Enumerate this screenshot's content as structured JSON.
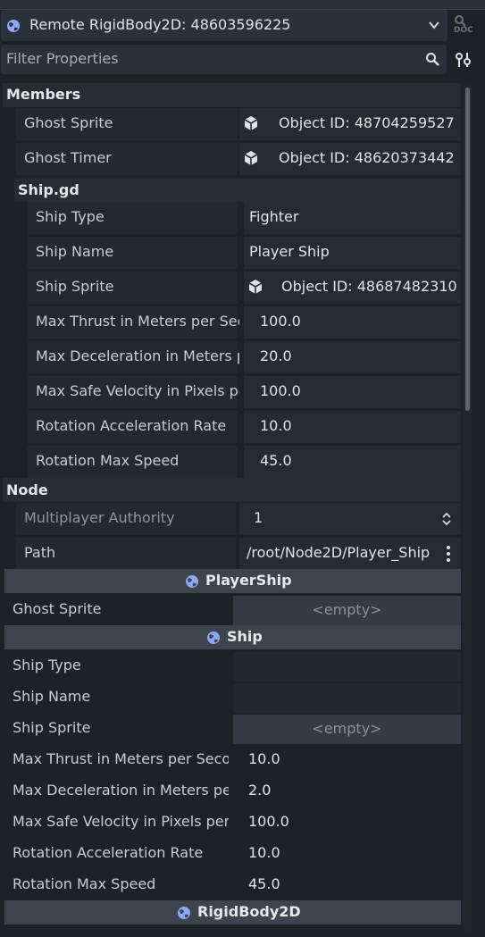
{
  "header": {
    "object_selector": "Remote RigidBody2D: 48603596225",
    "filter_placeholder": "Filter Properties",
    "doc_button": "DOC"
  },
  "members": {
    "title": "Members",
    "ghost_sprite_label": "Ghost Sprite",
    "ghost_sprite_value": "Object ID: 48704259527",
    "ghost_timer_label": "Ghost Timer",
    "ghost_timer_value": "Object ID: 48620373442"
  },
  "shipgd": {
    "title": "Ship.gd",
    "rows": [
      {
        "label": "Ship Type",
        "value": "Fighter"
      },
      {
        "label": "Ship Name",
        "value": "Player Ship"
      },
      {
        "label": "Ship Sprite",
        "value": "Object ID: 48687482310"
      },
      {
        "label": "Max Thrust in Meters per Seco",
        "value": "100.0"
      },
      {
        "label": "Max Deceleration in Meters p",
        "value": "20.0"
      },
      {
        "label": "Max Safe Velocity in Pixels per",
        "value": "100.0"
      },
      {
        "label": "Rotation Acceleration Rate",
        "value": "10.0"
      },
      {
        "label": "Rotation Max Speed",
        "value": "45.0"
      }
    ]
  },
  "node": {
    "title": "Node",
    "multiplayer_label": "Multiplayer Authority",
    "multiplayer_value": "1",
    "path_label": "Path",
    "path_value": "/root/Node2D/Player_Ship"
  },
  "playership": {
    "title": "PlayerShip",
    "ghost_sprite_label": "Ghost Sprite",
    "ghost_sprite_value": "<empty>"
  },
  "ship": {
    "title": "Ship",
    "ship_type_label": "Ship Type",
    "ship_name_label": "Ship Name",
    "ship_sprite_label": "Ship Sprite",
    "ship_sprite_value": "<empty>",
    "num_rows": [
      {
        "label": "Max Thrust in Meters per Secon",
        "value": "10.0"
      },
      {
        "label": "Max Deceleration in Meters per",
        "value": "2.0"
      },
      {
        "label": "Max Safe Velocity in Pixels per S",
        "value": "100.0"
      },
      {
        "label": "Rotation Acceleration Rate",
        "value": "10.0"
      },
      {
        "label": "Rotation Max Speed",
        "value": "45.0"
      }
    ]
  },
  "rigidbody": {
    "title": "RigidBody2D"
  },
  "colors": {
    "background": "#1d2229",
    "category_header": "#3d444e",
    "icon_globe": "#8da5f3"
  }
}
